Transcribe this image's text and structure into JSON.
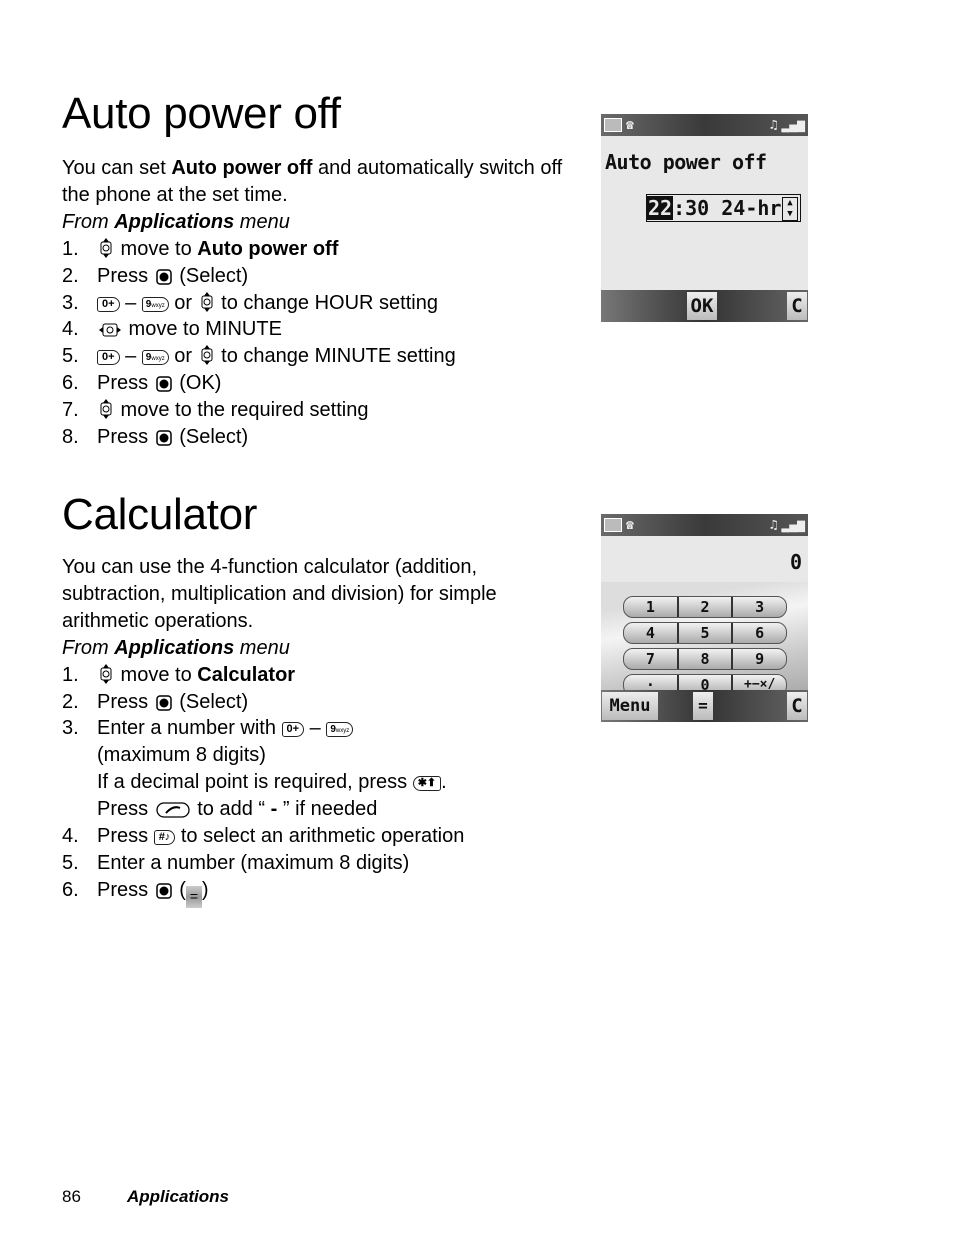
{
  "sections": {
    "auto_power_off": {
      "title": "Auto power off",
      "intro_pre": "You can set ",
      "intro_bold": "Auto power off",
      "intro_post": " and automatically switch off the phone at the set time.",
      "from_pre": "From ",
      "from_bold": "Applications",
      "from_post": " menu",
      "steps": [
        {
          "num": "1.",
          "pre": " move to ",
          "bold": "Auto power off"
        },
        {
          "num": "2.",
          "pre": "Press ",
          "post": " (Select)"
        },
        {
          "num": "3.",
          "dash": " – ",
          "or": " or ",
          "post": " to change HOUR setting"
        },
        {
          "num": "4.",
          "post": " move to MINUTE"
        },
        {
          "num": "5.",
          "dash": " – ",
          "or": " or ",
          "post": " to change MINUTE setting"
        },
        {
          "num": "6.",
          "pre": "Press ",
          "post": " (OK)"
        },
        {
          "num": "7.",
          "post": " move to the required setting"
        },
        {
          "num": "8.",
          "pre": "Press ",
          "post": " (Select)"
        }
      ],
      "screen": {
        "title": "Auto power off",
        "hour": "22",
        "rest": ":30 24-hr",
        "softkey_ok": "OK",
        "softkey_clear": "C"
      }
    },
    "calculator": {
      "title": "Calculator",
      "intro": "You can use the 4-function calculator (addition, subtraction, multiplication and division) for simple arithmetic operations.",
      "from_pre": "From ",
      "from_bold": "Applications",
      "from_post": " menu",
      "steps": [
        {
          "num": "1.",
          "pre": " move to ",
          "bold": "Calculator"
        },
        {
          "num": "2.",
          "pre": "Press ",
          "post": " (Select)"
        },
        {
          "num": "3.",
          "pre": "Enter a number with ",
          "dash": " – ",
          "line2": "(maximum 8 digits)",
          "line3": "If a decimal point is required, press ",
          "line3_post": ".",
          "line4_pre": "Press ",
          "line4_mid": " to add “ ",
          "line4_bold": "-",
          "line4_post": " ” if needed"
        },
        {
          "num": "4.",
          "pre": "Press ",
          "post": " to select an arithmetic operation"
        },
        {
          "num": "5.",
          "pre": "Enter a number (maximum 8 digits)"
        },
        {
          "num": "6.",
          "pre": "Press ",
          "paren_open": " (",
          "eq": "=",
          "paren_close": ")"
        }
      ],
      "screen": {
        "display": "0",
        "keys": [
          [
            "1",
            "2",
            "3"
          ],
          [
            "4",
            "5",
            "6"
          ],
          [
            "7",
            "8",
            "9"
          ],
          [
            "·",
            "0",
            "+−×/"
          ]
        ],
        "softkey_menu": "Menu",
        "softkey_equals": "=",
        "softkey_clear": "C"
      }
    }
  },
  "keys": {
    "zero": "0+",
    "nine": "9",
    "nine_sub": "wxyz",
    "star": "✱⬆",
    "hash": "#♪"
  },
  "footer": {
    "page": "86",
    "section": "Applications"
  }
}
